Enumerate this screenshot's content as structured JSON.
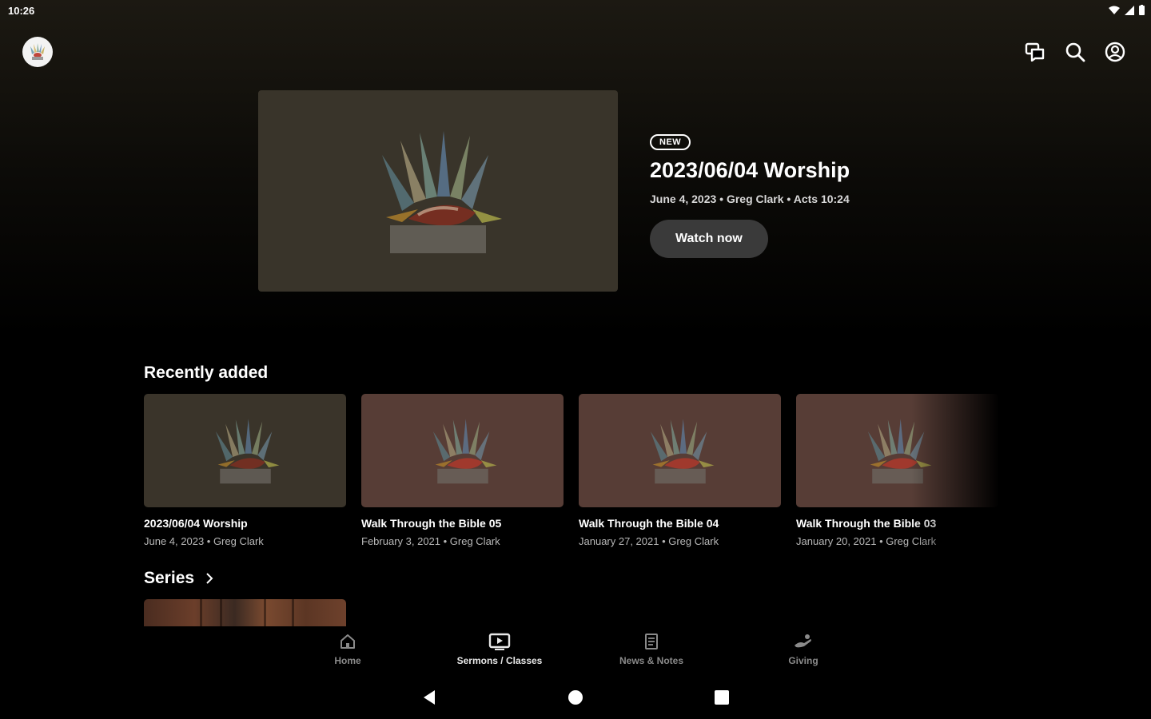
{
  "status": {
    "time": "10:26"
  },
  "hero": {
    "badge": "NEW",
    "title": "2023/06/04 Worship",
    "meta": "June 4, 2023 • Greg Clark • Acts 10:24",
    "watch_label": "Watch now",
    "thumb_color": "#39342a"
  },
  "recently_added": {
    "title": "Recently added",
    "items": [
      {
        "title": "2023/06/04 Worship",
        "meta": "June 4, 2023 • Greg Clark",
        "thumb_color": "#3a342a"
      },
      {
        "title": "Walk Through the Bible 05",
        "meta": "February 3, 2021 • Greg Clark",
        "thumb_color": "#573d36"
      },
      {
        "title": "Walk Through the Bible 04",
        "meta": "January 27, 2021 • Greg Clark",
        "thumb_color": "#573d36"
      },
      {
        "title": "Walk Through the Bible 03",
        "meta": "January 20, 2021 • Greg Clark",
        "thumb_color": "#573d36"
      }
    ]
  },
  "series": {
    "title": "Series"
  },
  "bottom_nav": {
    "items": [
      {
        "label": "Home",
        "icon": "home-icon"
      },
      {
        "label": "Sermons / Classes",
        "icon": "tv-icon"
      },
      {
        "label": "News & Notes",
        "icon": "notes-icon"
      },
      {
        "label": "Giving",
        "icon": "giving-icon"
      }
    ],
    "active": "Sermons / Classes"
  },
  "colors": {
    "accent_active": "#e8e8e8",
    "inactive": "#8a8a8a",
    "background": "#000000"
  }
}
